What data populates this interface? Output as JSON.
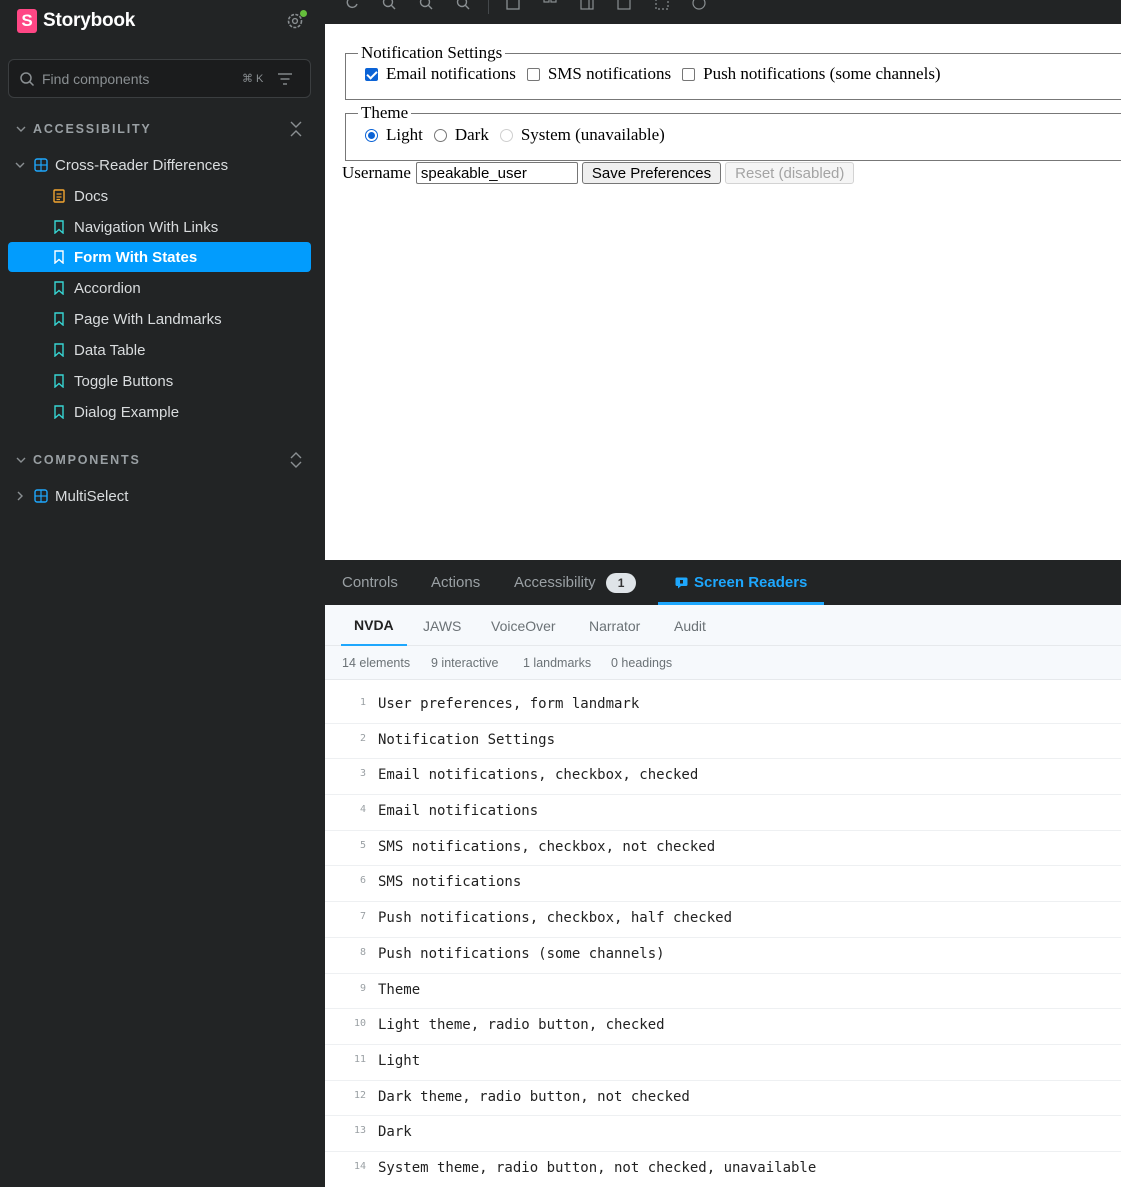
{
  "app": {
    "name": "Storybook",
    "logo_letter": "S"
  },
  "search": {
    "placeholder": "Find components",
    "shortcut": "⌘ K"
  },
  "sections": {
    "accessibility": {
      "title": "ACCESSIBILITY",
      "component": "Cross-Reader Differences",
      "items": [
        "Docs",
        "Navigation With Links",
        "Form With States",
        "Accordion",
        "Page With Landmarks",
        "Data Table",
        "Toggle Buttons",
        "Dialog Example"
      ],
      "selected": "Form With States"
    },
    "components": {
      "title": "COMPONENTS",
      "component": "MultiSelect"
    }
  },
  "preview": {
    "notifications": {
      "legend": "Notification Settings",
      "options": [
        {
          "label": "Email notifications",
          "checked": true
        },
        {
          "label": "SMS notifications",
          "checked": false
        },
        {
          "label": "Push notifications (some channels)",
          "checked": false
        }
      ]
    },
    "theme": {
      "legend": "Theme",
      "options": [
        {
          "label": "Light",
          "checked": true
        },
        {
          "label": "Dark",
          "checked": false
        },
        {
          "label": "System (unavailable)",
          "checked": false,
          "disabled": true
        }
      ]
    },
    "username_label": "Username",
    "username_value": "speakable_user",
    "save_label": "Save Preferences",
    "reset_label": "Reset (disabled)"
  },
  "addon_tabs": {
    "controls": "Controls",
    "actions": "Actions",
    "accessibility": "Accessibility",
    "accessibility_count": "1",
    "screen_readers": "Screen Readers"
  },
  "reader_tabs": [
    "NVDA",
    "JAWS",
    "VoiceOver",
    "Narrator",
    "Audit"
  ],
  "stats": [
    "14 elements",
    "9 interactive",
    "1 landmarks",
    "0 headings"
  ],
  "output": [
    {
      "n": "1",
      "text": "User preferences, form landmark"
    },
    {
      "n": "2",
      "text": "Notification Settings"
    },
    {
      "n": "3",
      "text": "Email notifications, checkbox, checked"
    },
    {
      "n": "4",
      "text": "Email notifications"
    },
    {
      "n": "5",
      "text": "SMS notifications, checkbox, not checked"
    },
    {
      "n": "6",
      "text": "SMS notifications"
    },
    {
      "n": "7",
      "text": "Push notifications, checkbox, half checked"
    },
    {
      "n": "8",
      "text": "Push notifications (some channels)"
    },
    {
      "n": "9",
      "text": "Theme"
    },
    {
      "n": "10",
      "text": "Light theme, radio button, checked"
    },
    {
      "n": "11",
      "text": "Light"
    },
    {
      "n": "12",
      "text": "Dark theme, radio button, not checked"
    },
    {
      "n": "13",
      "text": "Dark"
    },
    {
      "n": "14",
      "text": "System theme, radio button, not checked, unavailable"
    }
  ],
  "colors": {
    "accent": "#029cfd",
    "brand": "#ff4785",
    "sidebar_bg": "#222425"
  },
  "icons": {
    "settings": "settings-icon",
    "search": "search-icon",
    "filter": "filter-icon",
    "component": "component-icon",
    "story": "bookmark-icon",
    "docs": "document-icon"
  }
}
